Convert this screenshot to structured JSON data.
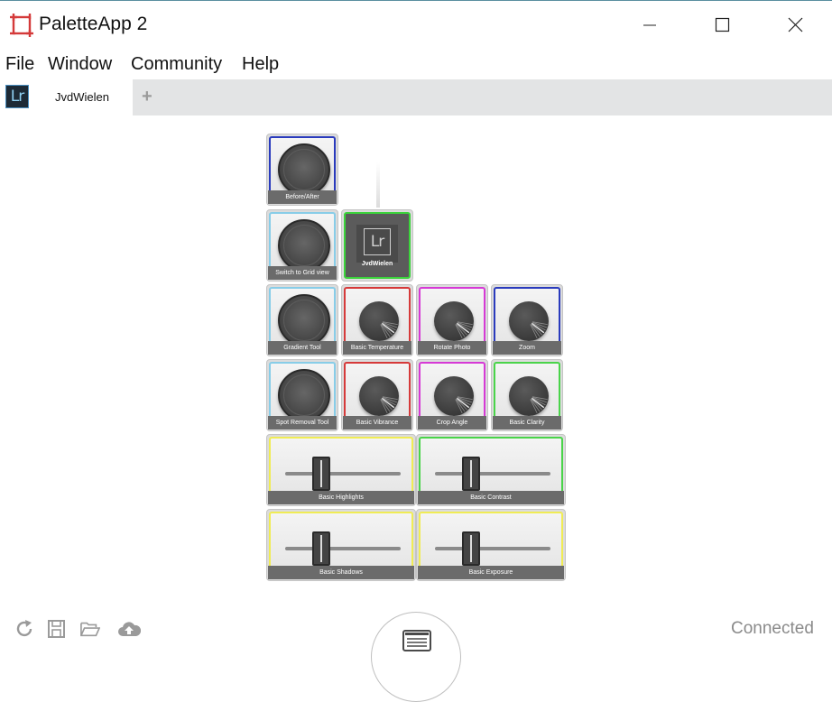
{
  "window": {
    "title": "PaletteApp 2"
  },
  "menu": [
    "File",
    "Window",
    "Community",
    "Help"
  ],
  "tabs": [
    {
      "badge": "Lr",
      "label": "JvdWielen"
    }
  ],
  "add_tab_label": "+",
  "core": {
    "logo_text": "Lr",
    "name": "JvdWielen",
    "border_color": "#3bd43b"
  },
  "modules": {
    "before_after": {
      "label": "Before/After",
      "type": "button",
      "border_color": "#2a3bbd"
    },
    "grid_view": {
      "label": "Switch to Grid view",
      "type": "button",
      "border_color": "#88cde8"
    },
    "gradient_tool": {
      "label": "Gradient Tool",
      "type": "button",
      "border_color": "#88cde8"
    },
    "basic_temperature": {
      "label": "Basic Temperature",
      "type": "dial",
      "border_color": "#d63a3a"
    },
    "rotate_photo": {
      "label": "Rotate Photo",
      "type": "dial",
      "border_color": "#d63ad6"
    },
    "zoom": {
      "label": "Zoom",
      "type": "dial",
      "border_color": "#2a3bbd"
    },
    "spot_removal": {
      "label": "Spot Removal Tool",
      "type": "button",
      "border_color": "#88cde8"
    },
    "basic_vibrance": {
      "label": "Basic Vibrance",
      "type": "dial",
      "border_color": "#d63a3a"
    },
    "crop_angle": {
      "label": "Crop Angle",
      "type": "dial",
      "border_color": "#d63ad6"
    },
    "basic_clarity": {
      "label": "Basic Clarity",
      "type": "dial",
      "border_color": "#4ad44a"
    },
    "basic_highlights": {
      "label": "Basic Highlights",
      "type": "slider",
      "border_color": "#f0ec55"
    },
    "basic_contrast": {
      "label": "Basic Contrast",
      "type": "slider",
      "border_color": "#4ad44a"
    },
    "basic_shadows": {
      "label": "Basic Shadows",
      "type": "slider",
      "border_color": "#f0ec55"
    },
    "basic_exposure": {
      "label": "Basic Exposure",
      "type": "slider",
      "border_color": "#f0ec55"
    }
  },
  "footer": {
    "icons": [
      "refresh-icon",
      "save-icon",
      "open-folder-icon",
      "cloud-upload-icon",
      "list-menu-icon"
    ],
    "status": "Connected"
  }
}
